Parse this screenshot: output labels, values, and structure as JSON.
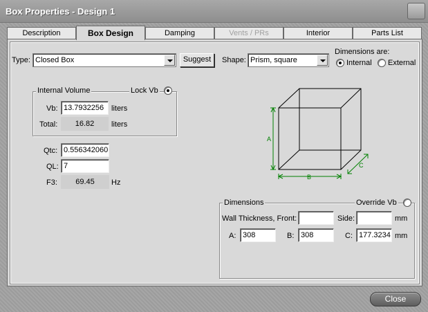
{
  "window": {
    "title": "Box Properties - Design 1"
  },
  "tabs": [
    {
      "label": "Description"
    },
    {
      "label": "Box Design"
    },
    {
      "label": "Damping"
    },
    {
      "label": "Vents / PRs"
    },
    {
      "label": "Interior"
    },
    {
      "label": "Parts List"
    }
  ],
  "type": {
    "label": "Type:",
    "value": "Closed Box",
    "suggest_label": "Suggest"
  },
  "shape": {
    "label": "Shape:",
    "value": "Prism, square"
  },
  "dimensions_are": {
    "label": "Dimensions are:",
    "internal": "Internal",
    "external": "External",
    "selected": "Internal"
  },
  "internal_volume": {
    "title": "Internal Volume",
    "lock_label": "Lock Vb",
    "vb_label": "Vb:",
    "vb_value": "13.7932256",
    "vb_unit": "liters",
    "total_label": "Total:",
    "total_value": "16.82",
    "total_unit": "liters"
  },
  "params": {
    "qtc_label": "Qtc:",
    "qtc_value": "0.556342060",
    "ql_label": "QL:",
    "ql_value": "7",
    "f3_label": "F3:",
    "f3_value": "69.45",
    "f3_unit": "Hz"
  },
  "diagram": {
    "a_label": "A",
    "b_label": "B",
    "c_label": "C",
    "line_color": "#000000",
    "dim_color": "#008000"
  },
  "dimensions": {
    "title": "Dimensions",
    "override_label": "Override Vb",
    "wall_front_label": "Wall Thickness, Front:",
    "wall_front_value": "",
    "side_label": "Side:",
    "side_value": "",
    "wall_unit": "mm",
    "a_label": "A:",
    "a_value": "308",
    "b_label": "B:",
    "b_value": "308",
    "c_label": "C:",
    "c_value": "177.3234",
    "c_unit": "mm"
  },
  "close_label": "Close"
}
